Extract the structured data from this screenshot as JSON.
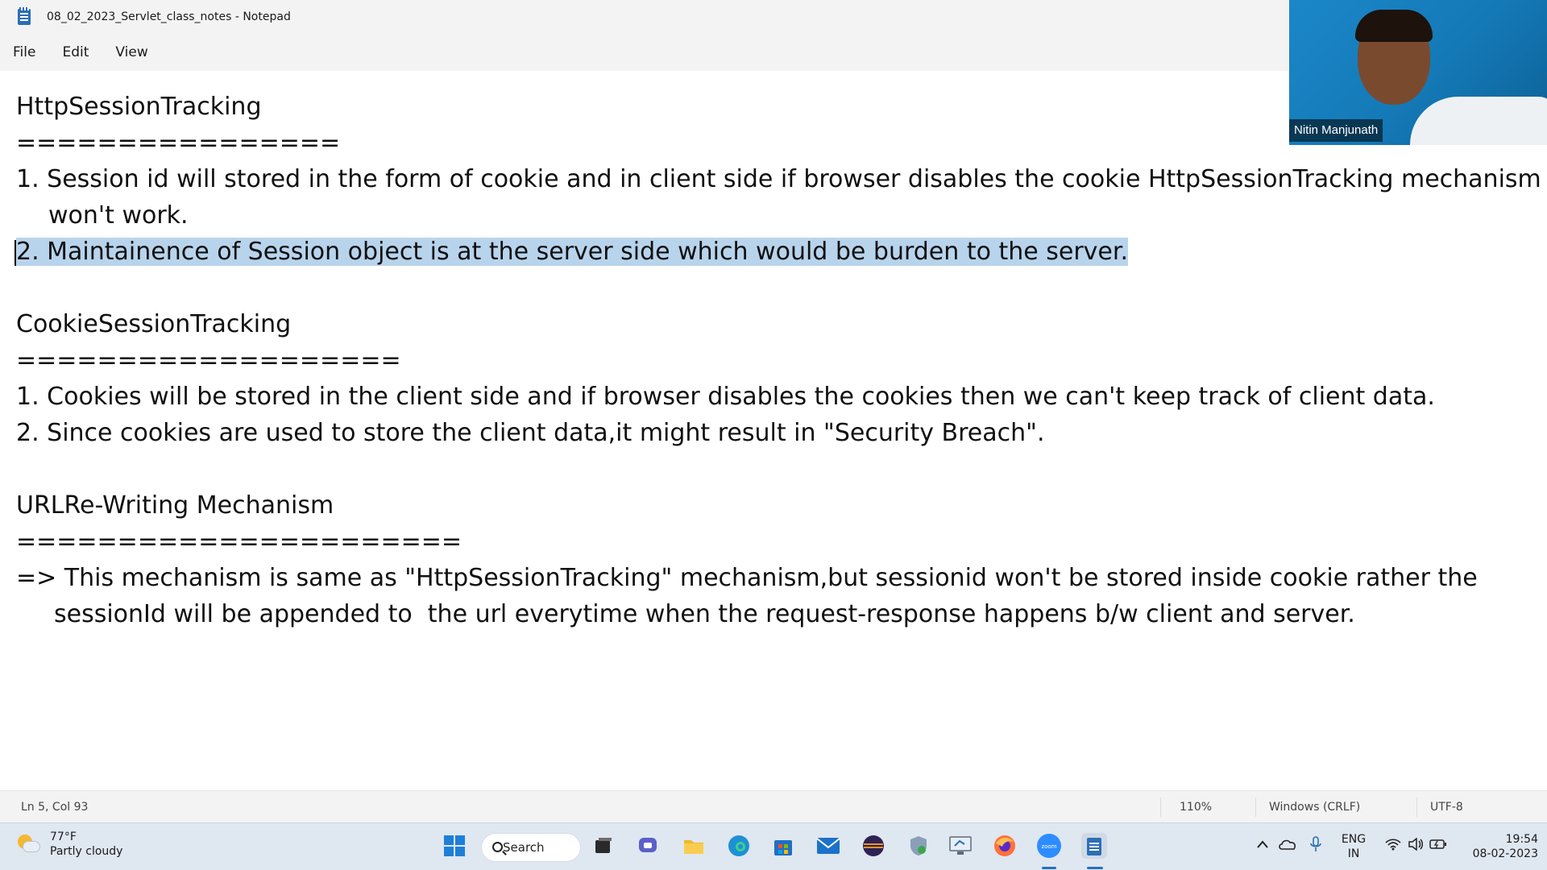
{
  "window": {
    "title": "08_02_2023_Servlet_class_notes - Notepad"
  },
  "menu": {
    "items": [
      "File",
      "Edit",
      "View"
    ]
  },
  "document": {
    "lines": [
      "HttpSessionTracking",
      "================",
      "1. Session id will stored in the form of cookie and in client side if browser disables the cookie HttpSessionTracking mechanism",
      "won't work.",
      "2. Maintainence of Session object is at the server side which would be burden to the server.",
      "CookieSessionTracking",
      "===================",
      "1. Cookies will be stored in the client side and if browser disables the cookies then we can't keep track of client data.",
      "2. Since cookies are used to store the client data,it might result in \"Security Breach\".",
      "URLRe-Writing Mechanism",
      "======================",
      "=> This mechanism is same as \"HttpSessionTracking\" mechanism,but sessionid won't be stored inside cookie rather the",
      "sessionId will be appended to  the url everytime when the request-response happens b/w client and server."
    ]
  },
  "webcam": {
    "participant_name": "Nitin Manjunath"
  },
  "status": {
    "position": "Ln 5, Col 93",
    "zoom": "110%",
    "line_ending": "Windows (CRLF)",
    "encoding": "UTF-8"
  },
  "taskbar": {
    "weather_temp": "77°F",
    "weather_desc": "Partly cloudy",
    "search_label": "Search",
    "lang_line1": "ENG",
    "lang_line2": "IN",
    "time": "19:54",
    "date": "08-02-2023"
  },
  "icons": [
    "notepad-icon",
    "windows-start-icon",
    "search-icon",
    "task-view-icon",
    "teams-chat-icon",
    "file-explorer-icon",
    "edge-icon",
    "store-icon",
    "mail-icon",
    "eclipse-icon",
    "security-icon",
    "remote-desktop-icon",
    "firefox-icon",
    "zoom-icon",
    "notepad-taskbar-icon",
    "chevron-up-icon",
    "onedrive-icon",
    "microphone-icon",
    "wifi-icon",
    "volume-icon",
    "battery-icon",
    "weather-icon"
  ]
}
